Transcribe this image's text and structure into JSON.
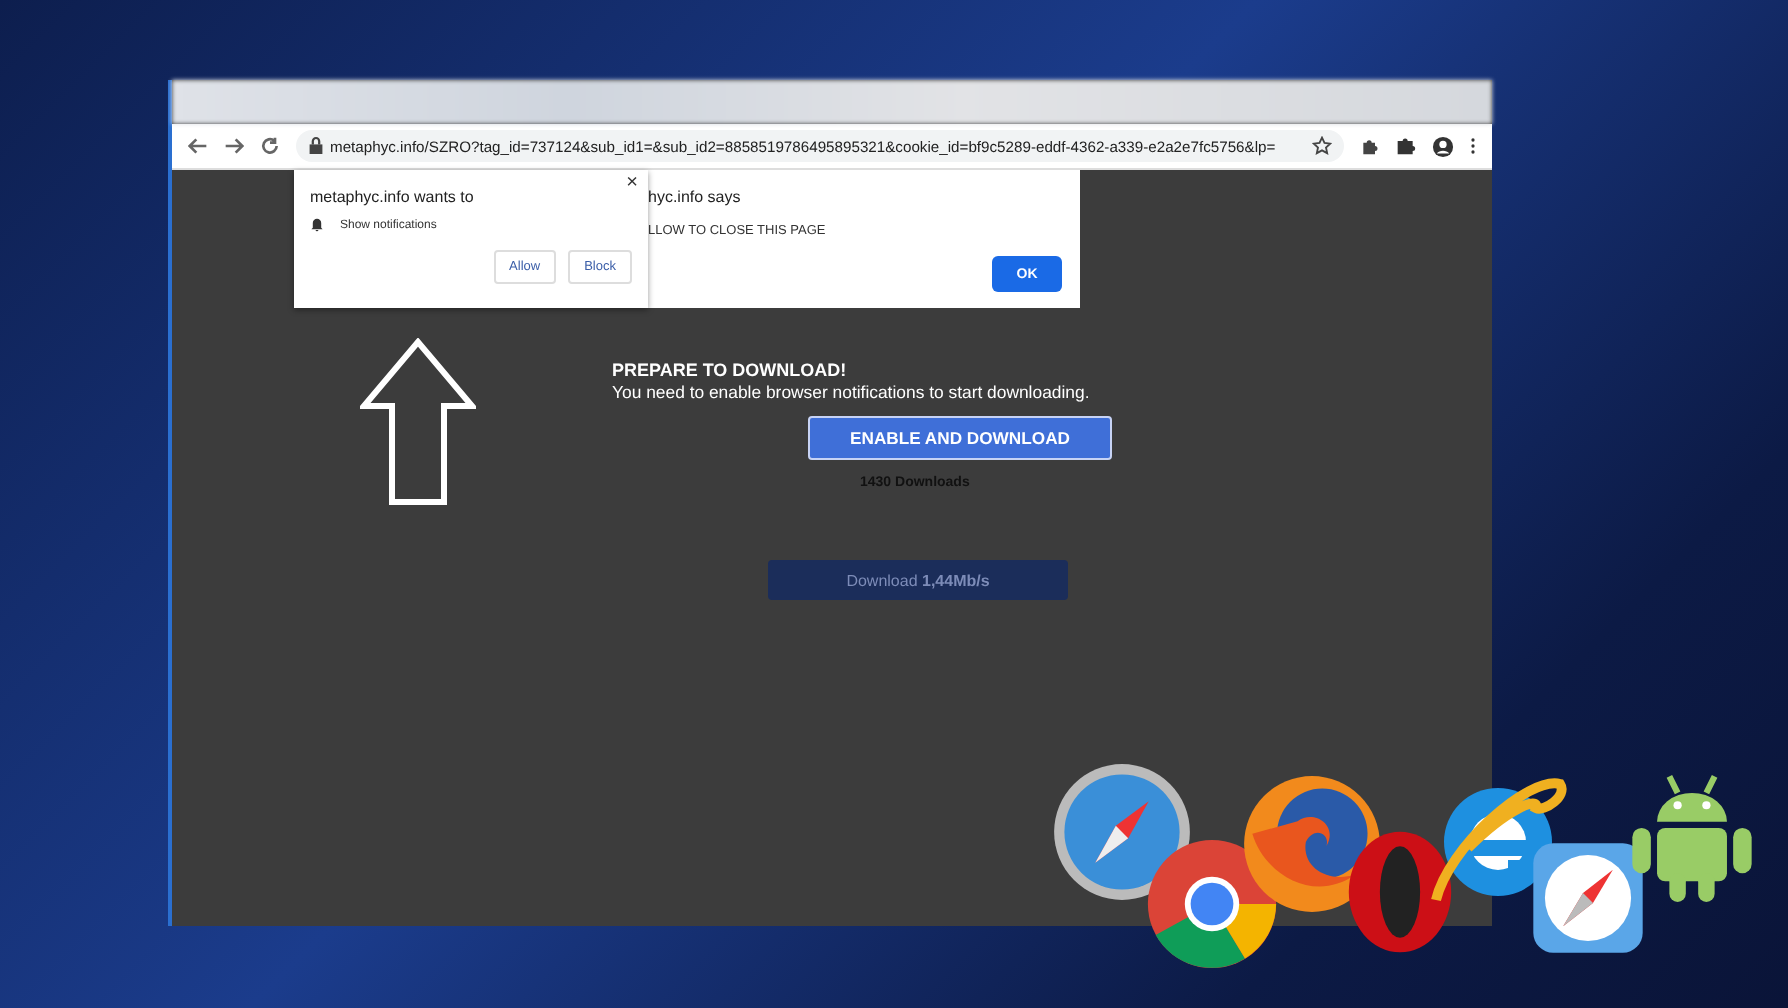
{
  "browser": {
    "url": "metaphyc.info/SZRO?tag_id=737124&sub_id1=&sub_id2=8858519786495895321&cookie_id=bf9c5289-eddf-4362-a339-e2a2e7fc5756&lp="
  },
  "notification_prompt": {
    "close": "×",
    "title": "metaphyc.info wants to",
    "permission": "Show notifications",
    "buttons": [
      "Allow",
      "Block"
    ]
  },
  "alert": {
    "title": "hyc.info says",
    "message": "LLOW TO CLOSE THIS PAGE",
    "button": "OK"
  },
  "page": {
    "heading": "PREPARE TO DOWNLOAD!",
    "subtext": "You need to enable browser notifications to start downloading.",
    "button": "ENABLE AND DOWNLOAD",
    "count": "1430 Downloads",
    "download_bar": "Download **1,44Mb/s**"
  },
  "logos": [
    {
      "kind": "safari"
    },
    {
      "kind": "chrome"
    },
    {
      "kind": "firefox"
    },
    {
      "kind": "opera"
    },
    {
      "kind": "ie"
    },
    {
      "kind": "safari-ios"
    },
    {
      "kind": "android"
    }
  ]
}
